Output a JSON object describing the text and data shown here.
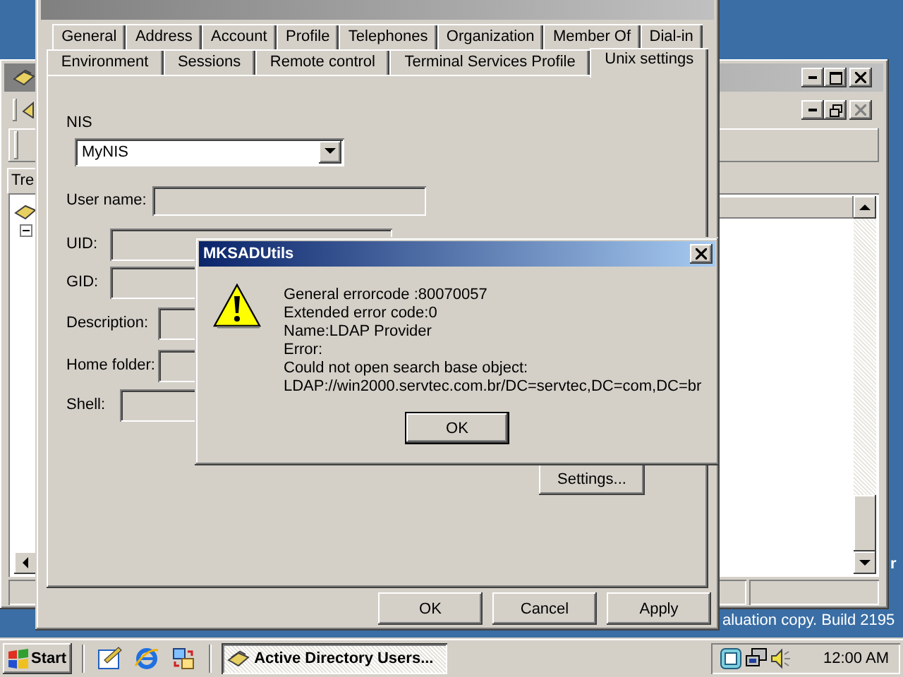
{
  "desktop": {
    "text_lines": [
      "r",
      "aluation copy. Build 2195"
    ]
  },
  "background_window": {
    "tree_tab": "Tre"
  },
  "properties_dialog": {
    "tab_rows": [
      [
        {
          "label": "General",
          "selected": false
        },
        {
          "label": "Address",
          "selected": false
        },
        {
          "label": "Account",
          "selected": false
        },
        {
          "label": "Profile",
          "selected": false
        },
        {
          "label": "Telephones",
          "selected": false
        },
        {
          "label": "Organization",
          "selected": false
        },
        {
          "label": "Member Of",
          "selected": false
        },
        {
          "label": "Dial-in",
          "selected": false
        }
      ],
      [
        {
          "label": "Environment",
          "selected": false
        },
        {
          "label": "Sessions",
          "selected": false
        },
        {
          "label": "Remote control",
          "selected": false
        },
        {
          "label": "Terminal Services Profile",
          "selected": false
        },
        {
          "label": "Unix settings",
          "selected": true
        }
      ]
    ],
    "nis": {
      "label": "NIS",
      "value": "MyNIS"
    },
    "fields": [
      {
        "label": "User name:"
      },
      {
        "label": "UID:"
      },
      {
        "label": "GID:"
      },
      {
        "label": "Description:"
      },
      {
        "label": "Home folder:"
      },
      {
        "label": "Shell:"
      }
    ],
    "settings_button": "Settings...",
    "buttons": [
      "OK",
      "Cancel",
      "Apply"
    ]
  },
  "message_box": {
    "title": "MKSADUtils",
    "lines": [
      "General errorcode :80070057",
      "Extended error code:0",
      "Name:LDAP Provider",
      "Error:",
      "Could not open search base object:",
      "LDAP://win2000.servtec.com.br/DC=servtec,DC=com,DC=br"
    ],
    "button": "OK"
  },
  "taskbar": {
    "start": "Start",
    "tasks": [
      {
        "label": "Active Directory Users...",
        "selected": true
      }
    ],
    "clock": "12:00 AM"
  }
}
